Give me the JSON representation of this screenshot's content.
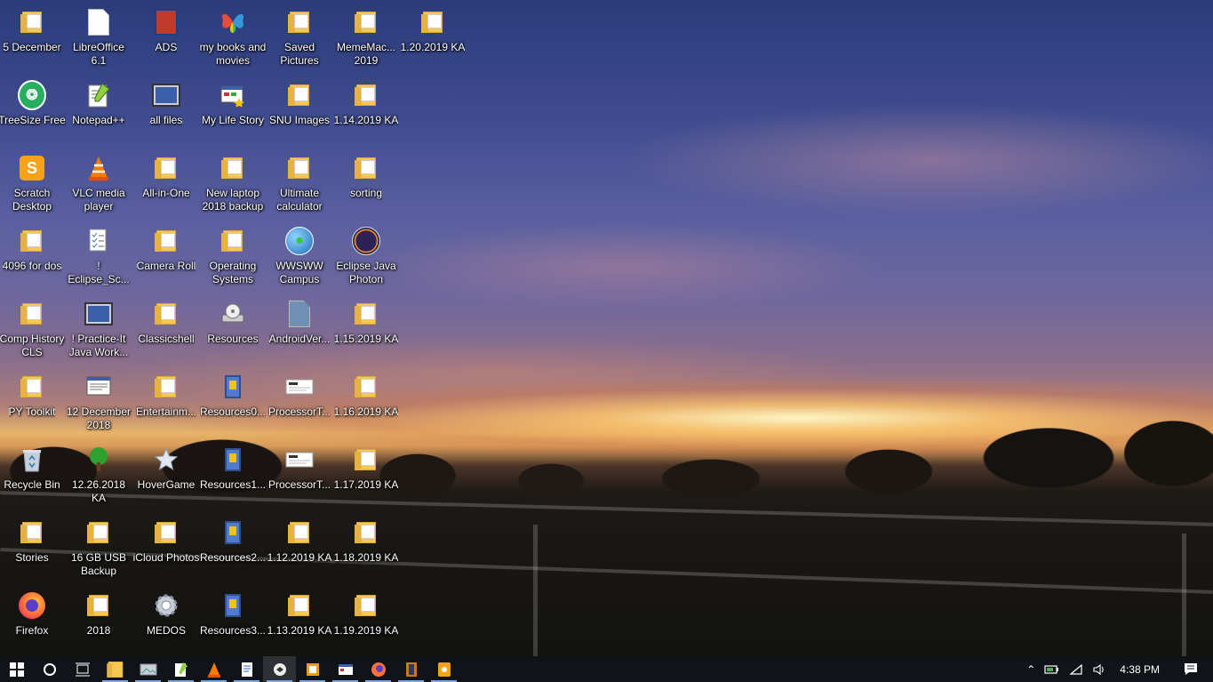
{
  "desktop": {
    "icons": [
      {
        "label": "5 December",
        "icon": "folder-icon"
      },
      {
        "label": "LibreOffice 6.1",
        "icon": "libreoffice-icon"
      },
      {
        "label": "ADS",
        "icon": "ads-book-icon"
      },
      {
        "label": "my books and movies",
        "icon": "butterfly-icon"
      },
      {
        "label": "Saved Pictures",
        "icon": "folder-icon"
      },
      {
        "label": "MemeMac... 2019",
        "icon": "folder-icon"
      },
      {
        "label": "1.20.2019 KA",
        "icon": "folder-icon"
      },
      {
        "label": "TreeSize Free",
        "icon": "treesize-icon"
      },
      {
        "label": "Notepad++",
        "icon": "notepadpp-icon"
      },
      {
        "label": "all files",
        "icon": "monitor-icon"
      },
      {
        "label": "My Life Story",
        "icon": "app-window-icon"
      },
      {
        "label": "SNU Images",
        "icon": "folder-icon"
      },
      {
        "label": "1.14.2019 KA",
        "icon": "folder-icon"
      },
      {
        "label": "Scratch Desktop",
        "icon": "scratch-icon"
      },
      {
        "label": "VLC media player",
        "icon": "vlc-icon"
      },
      {
        "label": "All-in-One",
        "icon": "folder-icon"
      },
      {
        "label": "New laptop 2018 backup",
        "icon": "folder-icon"
      },
      {
        "label": "Ultimate calculator",
        "icon": "folder-icon"
      },
      {
        "label": "sorting",
        "icon": "folder-icon"
      },
      {
        "label": "4096 for dos",
        "icon": "folder-icon"
      },
      {
        "label": "! Eclipse_Sc...",
        "icon": "checklist-icon"
      },
      {
        "label": "Camera Roll",
        "icon": "folder-icon"
      },
      {
        "label": "Operating Systems",
        "icon": "folder-icon"
      },
      {
        "label": "WWSWW Campus",
        "icon": "globe-icon"
      },
      {
        "label": "Eclipse Java Photon",
        "icon": "eclipse-icon"
      },
      {
        "label": "Comp History CLS",
        "icon": "folder-icon"
      },
      {
        "label": "! Practice-It Java Work...",
        "icon": "monitor-icon"
      },
      {
        "label": "Classicshell",
        "icon": "folder-icon"
      },
      {
        "label": "Resources",
        "icon": "disk-drive-icon"
      },
      {
        "label": "AndroidVer...",
        "icon": "file-icon"
      },
      {
        "label": "1.15.2019 KA",
        "icon": "folder-icon"
      },
      {
        "label": "PY Toolkit",
        "icon": "folder-icon"
      },
      {
        "label": "12 December 2018",
        "icon": "document-window-icon"
      },
      {
        "label": "Entertainm...",
        "icon": "folder-icon"
      },
      {
        "label": "Resources0...",
        "icon": "book-icon"
      },
      {
        "label": "ProcessorT...",
        "icon": "screenshot-icon"
      },
      {
        "label": "1.16.2019 KA",
        "icon": "folder-icon"
      },
      {
        "label": "Recycle Bin",
        "icon": "recycle-bin-icon"
      },
      {
        "label": "12.26.2018 KA",
        "icon": "tree-icon"
      },
      {
        "label": "HoverGame",
        "icon": "star-icon"
      },
      {
        "label": "Resources1...",
        "icon": "book-icon"
      },
      {
        "label": "ProcessorT...",
        "icon": "screenshot-icon"
      },
      {
        "label": "1.17.2019 KA",
        "icon": "folder-icon"
      },
      {
        "label": "Stories",
        "icon": "folder-icon"
      },
      {
        "label": "16 GB USB Backup",
        "icon": "folder-icon"
      },
      {
        "label": "iCloud Photos",
        "icon": "folder-icon"
      },
      {
        "label": "Resources2...",
        "icon": "book-icon"
      },
      {
        "label": "1.12.2019 KA",
        "icon": "folder-icon"
      },
      {
        "label": "1.18.2019 KA",
        "icon": "folder-icon"
      },
      {
        "label": "Firefox",
        "icon": "firefox-icon"
      },
      {
        "label": "2018",
        "icon": "folder-icon"
      },
      {
        "label": "MEDOS",
        "icon": "gear-icon"
      },
      {
        "label": "Resources3...",
        "icon": "book-icon"
      },
      {
        "label": "1.13.2019 KA",
        "icon": "folder-icon"
      },
      {
        "label": "1.19.2019 KA",
        "icon": "folder-icon"
      }
    ]
  },
  "taskbar": {
    "pinned": [
      {
        "name": "start-button",
        "icon": "windows-logo-icon"
      },
      {
        "name": "cortana-button",
        "icon": "cortana-circle-icon"
      },
      {
        "name": "task-view-button",
        "icon": "task-view-icon"
      },
      {
        "name": "file-explorer-button",
        "icon": "folder-icon"
      },
      {
        "name": "photos-app-button",
        "icon": "photos-icon"
      },
      {
        "name": "notepadpp-button",
        "icon": "notepadpp-icon"
      },
      {
        "name": "vlc-button",
        "icon": "vlc-icon"
      },
      {
        "name": "document-button",
        "icon": "document-icon"
      },
      {
        "name": "snipping-button",
        "icon": "snipping-icon"
      },
      {
        "name": "paint-button",
        "icon": "paint-icon"
      },
      {
        "name": "app-window-button",
        "icon": "app-window-icon"
      },
      {
        "name": "firefox-button",
        "icon": "firefox-icon"
      },
      {
        "name": "media-button",
        "icon": "film-icon"
      },
      {
        "name": "scratch-button",
        "icon": "scratch-icon"
      }
    ],
    "tray": {
      "time": "4:38 PM"
    }
  },
  "colors": {
    "taskbar_bg": "#101418",
    "folder": "#f5c856",
    "accent": "#7aa7e8"
  }
}
